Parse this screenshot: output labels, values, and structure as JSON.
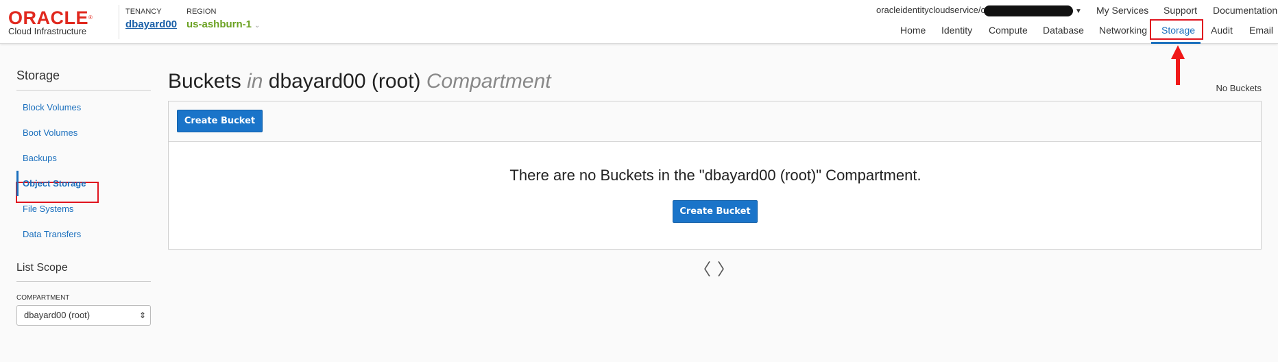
{
  "header": {
    "logo_word": "ORACLE",
    "logo_sub": "Cloud Infrastructure",
    "tenancy_caption": "TENANCY",
    "tenancy_value": "dbayard00",
    "region_caption": "REGION",
    "region_value": "us-ashburn-1",
    "user_text": "oracleidentitycloudservice/c",
    "top_links": [
      "My Services",
      "Support",
      "Documentation"
    ],
    "nav_tabs": [
      "Home",
      "Identity",
      "Compute",
      "Database",
      "Networking",
      "Storage",
      "Audit",
      "Email"
    ],
    "active_tab": "Storage"
  },
  "sidebar": {
    "title": "Storage",
    "items": [
      "Block Volumes",
      "Boot Volumes",
      "Backups",
      "Object Storage",
      "File Systems",
      "Data Transfers"
    ],
    "active_item": "Object Storage",
    "scope_title": "List Scope",
    "compartment_label": "COMPARTMENT",
    "compartment_value": "dbayard00 (root)"
  },
  "main": {
    "title_part1": "Buckets ",
    "title_in": "in",
    "title_part2": " dbayard00 (root) ",
    "title_compartment": "Compartment",
    "count_text": "No Buckets",
    "create_button": "Create Bucket",
    "empty_message": "There are no Buckets in the \"dbayard00 (root)\" Compartment.",
    "empty_create_button": "Create Bucket",
    "prev_glyph": "〈",
    "next_glyph": "〉"
  },
  "colors": {
    "oracle_red": "#e0281e",
    "link_blue": "#1a6fbd",
    "primary_button": "#1a74c9",
    "region_green": "#6aa121",
    "highlight_red": "#e0141e"
  }
}
